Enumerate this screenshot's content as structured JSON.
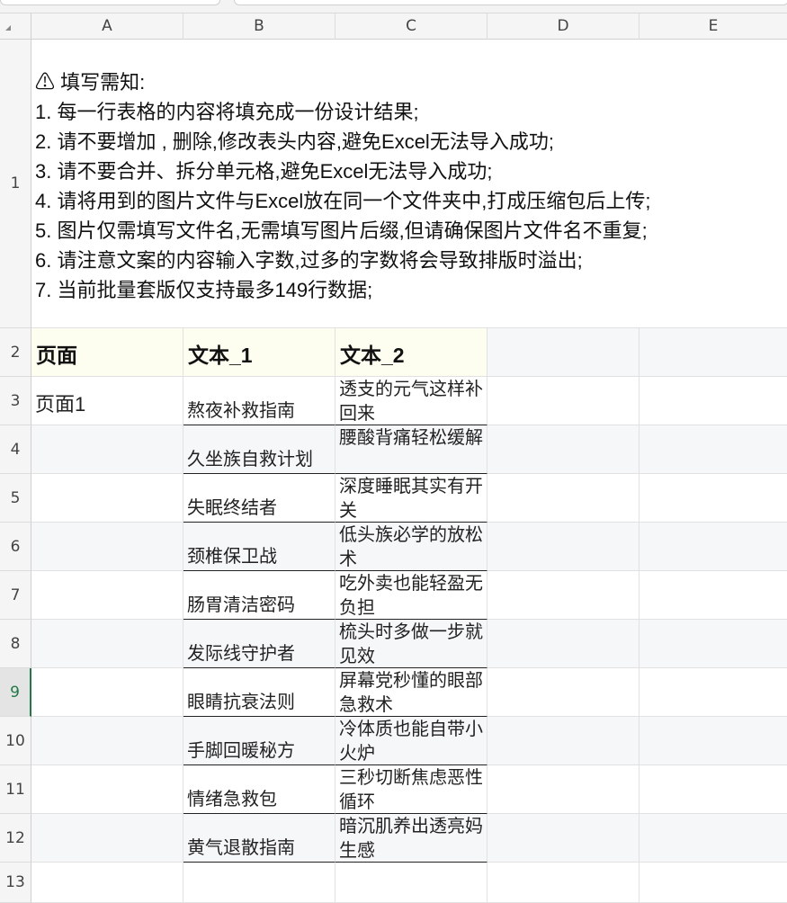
{
  "columns": [
    "A",
    "B",
    "C",
    "D",
    "E"
  ],
  "rows": [
    "1",
    "2",
    "3",
    "4",
    "5",
    "6",
    "7",
    "8",
    "9",
    "10",
    "11",
    "12",
    "13"
  ],
  "selected_row": "9",
  "instructions": {
    "icon": "warning-icon",
    "title": "⚠ 填写需知:",
    "lines": [
      "1. 每一行表格的内容将填充成一份设计结果;",
      "2. 请不要增加 , 删除,修改表头内容,避免Excel无法导入成功;",
      "3. 请不要合并、拆分单元格,避免Excel无法导入成功;",
      "4. 请将用到的图片文件与Excel放在同一个文件夹中,打成压缩包后上传;",
      "5. 图片仅需填写文件名,无需填写图片后缀,但请确保图片文件名不重复;",
      "6. 请注意文案的内容输入字数,过多的字数将会导致排版时溢出;",
      "7. 当前批量套版仅支持最多149行数据;"
    ]
  },
  "headers": {
    "page": "页面",
    "text1": "文本_1",
    "text2": "文本_2"
  },
  "data_rows": [
    {
      "page": "页面1",
      "text1": "熬夜补救指南",
      "text2": "透支的元气这样补回来"
    },
    {
      "page": "",
      "text1": "久坐族自救计划",
      "text2": "腰酸背痛轻松缓解"
    },
    {
      "page": "",
      "text1": "失眠终结者",
      "text2": "深度睡眠其实有开关"
    },
    {
      "page": "",
      "text1": "颈椎保卫战",
      "text2": "低头族必学的放松术"
    },
    {
      "page": "",
      "text1": "肠胃清洁密码",
      "text2": "吃外卖也能轻盈无负担"
    },
    {
      "page": "",
      "text1": "发际线守护者",
      "text2": "梳头时多做一步就见效"
    },
    {
      "page": "",
      "text1": "眼睛抗衰法则",
      "text2": "屏幕党秒懂的眼部急救术"
    },
    {
      "page": "",
      "text1": "手脚回暖秘方",
      "text2": "冷体质也能自带小火炉"
    },
    {
      "page": "",
      "text1": "情绪急救包",
      "text2": "三秒切断焦虑恶性循环"
    },
    {
      "page": "",
      "text1": "黄气退散指南",
      "text2": "暗沉肌养出透亮妈生感"
    }
  ],
  "colors": {
    "header_fill": "#fdfdf0",
    "selected_row_accent": "#1f7a45"
  }
}
